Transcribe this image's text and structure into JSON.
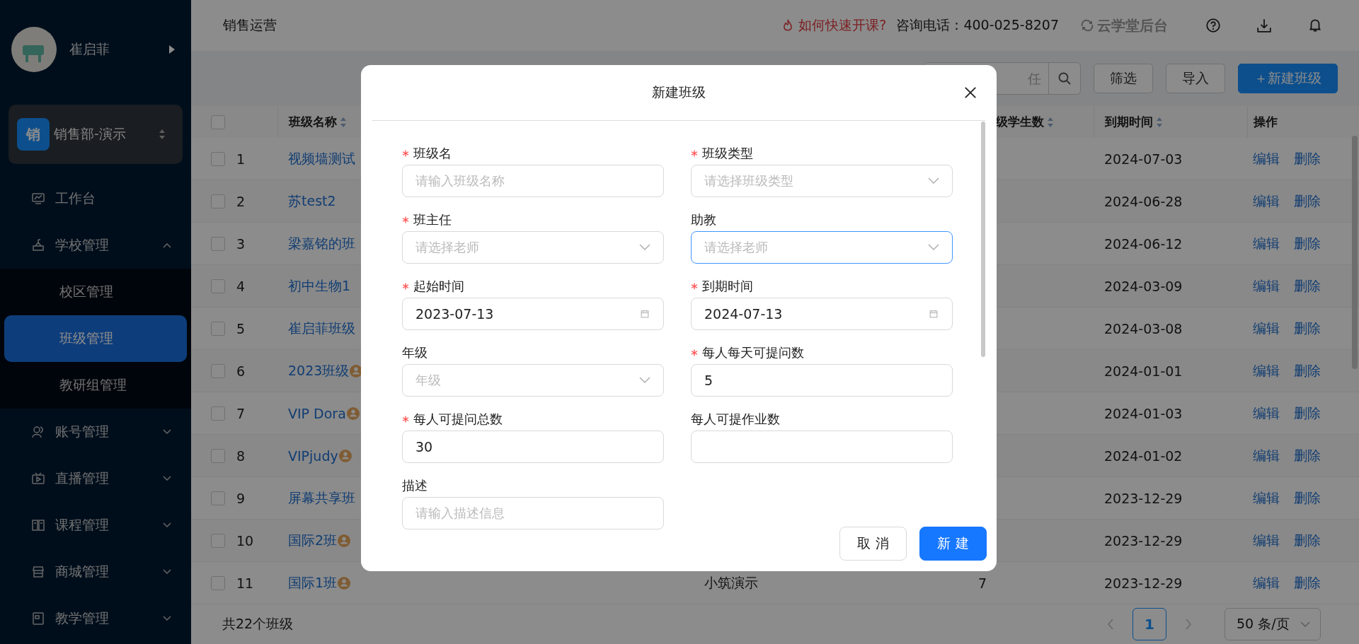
{
  "sidebar": {
    "user": {
      "name": "崔启菲"
    },
    "org": {
      "badge": "销",
      "name": "销售部-演示"
    },
    "items": [
      {
        "label": "工作台",
        "selected": false
      },
      {
        "label": "学校管理",
        "selected": false,
        "expanded": true,
        "children": [
          {
            "label": "校区管理",
            "selected": false
          },
          {
            "label": "班级管理",
            "selected": true
          },
          {
            "label": "教研组管理",
            "selected": false
          }
        ]
      },
      {
        "label": "账号管理",
        "selected": false,
        "expanded": false
      },
      {
        "label": "直播管理",
        "selected": false,
        "expanded": false
      },
      {
        "label": "课程管理",
        "selected": false,
        "expanded": false
      },
      {
        "label": "商城管理",
        "selected": false,
        "expanded": false
      },
      {
        "label": "教学管理",
        "selected": false,
        "expanded": false
      }
    ]
  },
  "header": {
    "breadcrumb": "销售运营",
    "help_link": "如何快速开课?",
    "phone": "咨询电话：400-025-8207",
    "brand": "云学堂后台"
  },
  "toolbar": {
    "search": {
      "placeholder": "任"
    },
    "buttons": [
      {
        "label": "筛选",
        "kind": "default"
      },
      {
        "label": "导入",
        "kind": "default"
      },
      {
        "label": "＋新建班级",
        "kind": "primary"
      }
    ]
  },
  "table": {
    "select_all": {
      "checked": false
    },
    "columns": [
      {
        "label": "班级名称",
        "sortable": true
      },
      {
        "label": "级学生数",
        "sortable": true
      },
      {
        "label": "到期时间",
        "sortable": true
      },
      {
        "label": "操作",
        "sortable": false
      }
    ],
    "rows": [
      {
        "checked": false,
        "index": "1",
        "name": "视频墙测试",
        "badge": false,
        "expiry": "2024-07-03",
        "actions": [
          "编辑",
          "删除"
        ]
      },
      {
        "checked": false,
        "index": "2",
        "name": "苏test2",
        "badge": false,
        "expiry": "2024-06-28",
        "actions": [
          "编辑",
          "删除"
        ]
      },
      {
        "checked": false,
        "index": "3",
        "name": "梁嘉铭的班",
        "badge": false,
        "expiry": "2024-06-12",
        "actions": [
          "编辑",
          "删除"
        ]
      },
      {
        "checked": false,
        "index": "4",
        "name": "初中生物1",
        "badge": false,
        "expiry": "2024-03-09",
        "actions": [
          "编辑",
          "删除"
        ]
      },
      {
        "checked": false,
        "index": "5",
        "name": "崔启菲班级",
        "badge": false,
        "expiry": "2024-03-08",
        "actions": [
          "编辑",
          "删除"
        ]
      },
      {
        "checked": false,
        "index": "6",
        "name": "2023班级",
        "badge": true,
        "expiry": "2024-01-01",
        "actions": [
          "编辑",
          "删除"
        ]
      },
      {
        "checked": false,
        "index": "7",
        "name": "VIP Dora",
        "badge": true,
        "expiry": "2024-01-03",
        "actions": [
          "编辑",
          "删除"
        ]
      },
      {
        "checked": false,
        "index": "8",
        "name": "VIPjudy",
        "badge": true,
        "expiry": "2024-01-02",
        "actions": [
          "编辑",
          "删除"
        ]
      },
      {
        "checked": false,
        "index": "9",
        "name": "屏幕共享班",
        "badge": false,
        "expiry": "2023-12-29",
        "actions": [
          "编辑",
          "删除"
        ]
      },
      {
        "checked": false,
        "index": "10",
        "name": "国际2班",
        "badge": true,
        "expiry": "2023-12-29",
        "actions": [
          "编辑",
          "删除"
        ]
      },
      {
        "checked": false,
        "index": "11",
        "name": "国际1班",
        "badge": true,
        "column_3": "小筑演示",
        "students": "7",
        "expiry": "2023-12-29",
        "actions": [
          "编辑",
          "删除"
        ]
      }
    ]
  },
  "footer": {
    "total": "共22个班级",
    "pages": [
      {
        "label": "1",
        "selected": true
      }
    ],
    "page_size": "50 条/页"
  },
  "modal": {
    "title": "新建班级",
    "fields": [
      {
        "label": "班级名",
        "required": true,
        "kind": "text",
        "placeholder": "请输入班级名称",
        "focused": false
      },
      {
        "label": "班级类型",
        "required": true,
        "kind": "select",
        "placeholder": "请选择班级类型",
        "focused": false
      },
      {
        "label": "班主任",
        "required": true,
        "kind": "select",
        "placeholder": "请选择老师",
        "focused": false
      },
      {
        "label": "助教",
        "required": false,
        "kind": "select",
        "placeholder": "请选择老师",
        "focused": true
      },
      {
        "label": "起始时间",
        "required": true,
        "kind": "date",
        "value": "2023-07-13",
        "focused": false
      },
      {
        "label": "到期时间",
        "required": true,
        "kind": "date",
        "value": "2024-07-13",
        "focused": false
      },
      {
        "label": "年级",
        "required": false,
        "kind": "select",
        "placeholder": "年级",
        "focused": false
      },
      {
        "label": "每人每天可提问数",
        "required": true,
        "kind": "text",
        "value": "5",
        "focused": false
      },
      {
        "label": "每人可提问总数",
        "required": true,
        "kind": "text",
        "value": "30",
        "focused": false
      },
      {
        "label": "每人可提作业数",
        "required": false,
        "kind": "text",
        "focused": false
      },
      {
        "label": "描述",
        "required": false,
        "kind": "text",
        "placeholder": "请输入描述信息",
        "focused": false
      }
    ],
    "buttons": [
      {
        "label": "取 消",
        "kind": "default"
      },
      {
        "label": "新 建",
        "kind": "primary"
      }
    ]
  }
}
